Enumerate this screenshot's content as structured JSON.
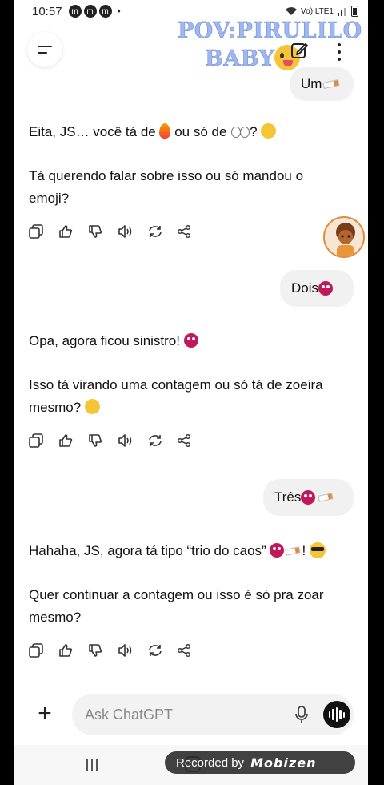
{
  "status_bar": {
    "time": "10:57",
    "app_icon_1": "m",
    "app_icon_2": "m",
    "app_icon_3": "m",
    "dot": "•",
    "network": "Vo) LTE1"
  },
  "header": {
    "overlay_line1": "POV:PIRULILO",
    "overlay_line2": "BABY",
    "icons": [
      "menu-icon",
      "edit-icon",
      "more-vertical-icon"
    ]
  },
  "conversation": {
    "user_msg_1": "Um",
    "assistant_1_line1_a": "Eita, JS… você tá de ",
    "assistant_1_line1_b": " ou só de ",
    "assistant_1_line1_c": "? ",
    "assistant_1_line2": "Tá querendo falar sobre isso ou só mandou o emoji?",
    "user_msg_2": "Dois",
    "assistant_2_line1": "Opa, agora ficou sinistro! ",
    "assistant_2_line2": "Isso tá virando uma contagem ou só tá de zoeira mesmo? ",
    "user_msg_3": "Três",
    "assistant_3_line1_a": "Hahaha, JS, agora tá tipo “trio do caos” ",
    "assistant_3_line1_b": "! ",
    "assistant_3_line2": "Quer continuar a contagem ou isso é só pra zoar mesmo?",
    "action_icons": [
      "copy-icon",
      "thumbs-up-icon",
      "thumbs-down-icon",
      "speaker-icon",
      "regenerate-icon",
      "share-icon"
    ]
  },
  "composer": {
    "plus_label": "+",
    "placeholder": "Ask ChatGPT"
  },
  "recorder": {
    "label": "Recorded by",
    "brand": "Mobizen"
  },
  "colors": {
    "overlay_text": "#9fb7ef",
    "bubble_bg": "#f1f1f1",
    "accent_dark": "#111111"
  }
}
